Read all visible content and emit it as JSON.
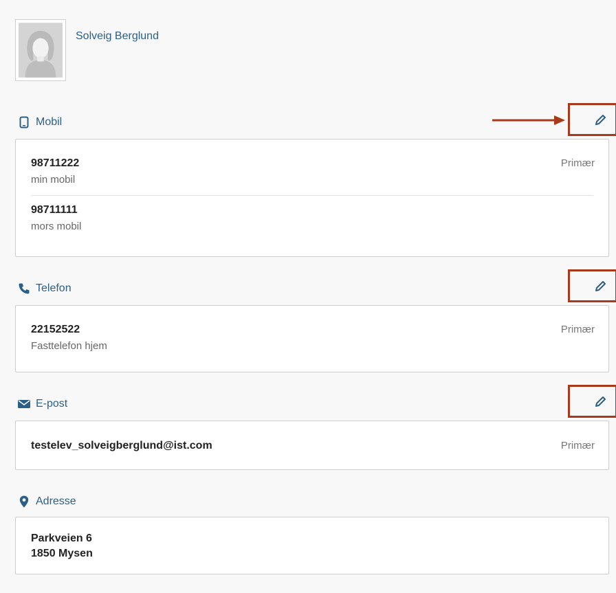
{
  "profile": {
    "name": "Solveig Berglund"
  },
  "sections": {
    "mobil": {
      "label": "Mobil",
      "icon": "mobile-phone-icon",
      "entries": [
        {
          "number": "98711222",
          "desc": "min mobil",
          "primary": "Primær"
        },
        {
          "number": "98711111",
          "desc": "mors mobil",
          "primary": ""
        }
      ]
    },
    "telefon": {
      "label": "Telefon",
      "icon": "phone-icon",
      "entries": [
        {
          "number": "22152522",
          "desc": "Fasttelefon hjem",
          "primary": "Primær"
        }
      ]
    },
    "epost": {
      "label": "E-post",
      "icon": "envelope-icon",
      "entries": [
        {
          "address": "testelev_solveigberglund@ist.com",
          "primary": "Primær"
        }
      ]
    },
    "adresse": {
      "label": "Adresse",
      "icon": "map-marker-icon",
      "lines": [
        "Parkveien 6",
        "1850 Mysen"
      ]
    }
  },
  "colors": {
    "accent": "#2a5f8a",
    "highlight": "#a8391a",
    "background": "#f8f8f8"
  }
}
